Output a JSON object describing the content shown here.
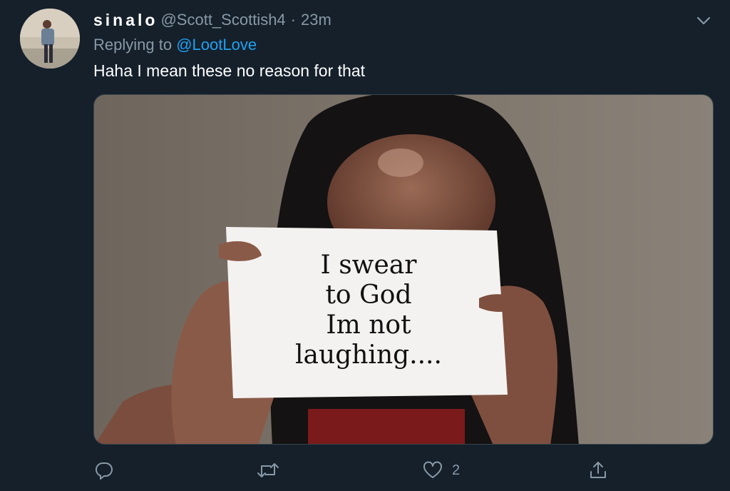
{
  "tweet": {
    "display_name": "sinalo",
    "handle": "@Scott_Scottish4",
    "separator": "·",
    "time": "23m",
    "replying_prefix": "Replying to",
    "replying_to": "@LootLove",
    "text": "Haha I mean these no reason for that"
  },
  "media": {
    "sign_lines": [
      "I swear",
      "to God",
      "Im not",
      "laughing...."
    ]
  },
  "actions": {
    "reply_count": "",
    "retweet_count": "",
    "like_count": "2"
  },
  "icons": {
    "more": "chevron-down-icon",
    "reply": "reply-icon",
    "retweet": "retweet-icon",
    "like": "heart-icon",
    "share": "share-icon"
  },
  "colors": {
    "background": "#15202b",
    "text": "#ffffff",
    "muted": "#8899a6",
    "link": "#1da1f2",
    "border": "#38444d"
  }
}
